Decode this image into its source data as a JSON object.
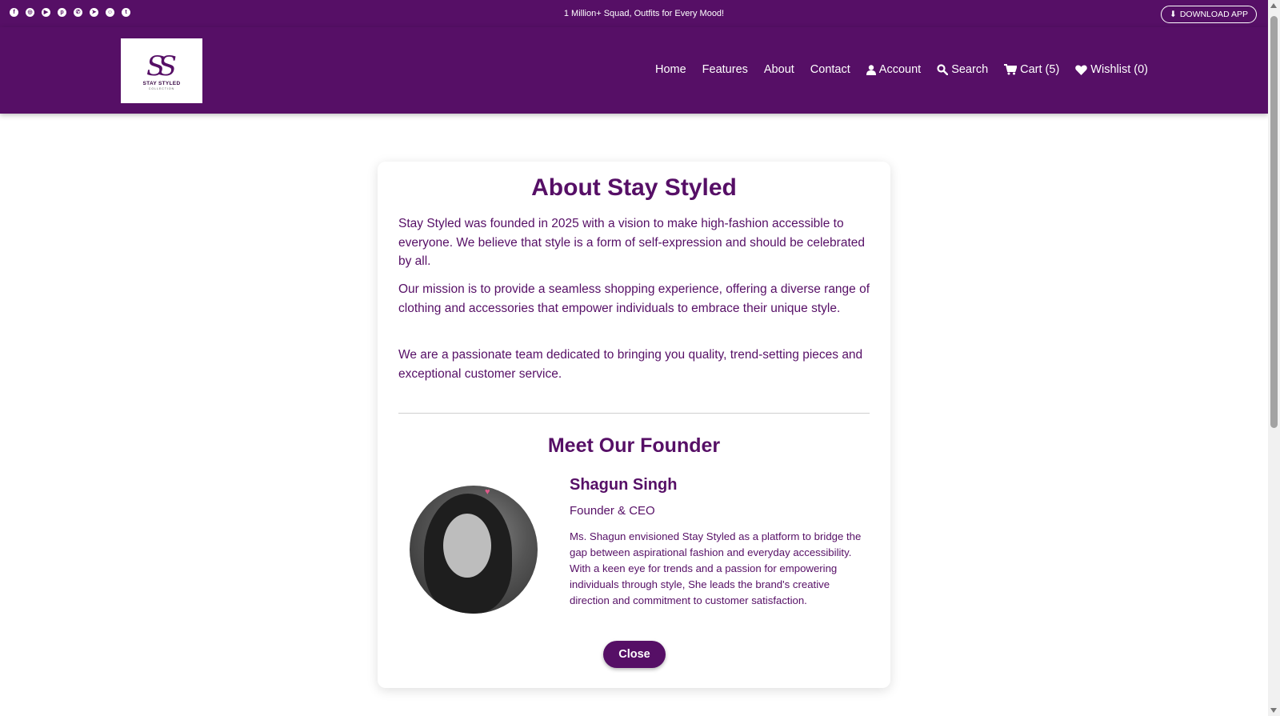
{
  "topbar": {
    "social_icons": [
      "facebook-icon",
      "instagram-icon",
      "youtube-icon",
      "pinterest-icon",
      "whatsapp-icon",
      "telegram-icon",
      "snapchat-icon",
      "twitter-icon"
    ],
    "social_glyphs": [
      "f",
      "◎",
      "▶",
      "p",
      "✆",
      "➤",
      "☺",
      "t"
    ],
    "promo_text": "1 Million+ Squad, Outfits for Every Mood!",
    "download_label": "DOWNLOAD APP"
  },
  "header": {
    "logo_mark": "SS",
    "logo_text": "STAY STYLED",
    "logo_sub": "COLLECTION",
    "nav": {
      "home": "Home",
      "features": "Features",
      "about": "About",
      "contact": "Contact",
      "account": "Account",
      "search": "Search",
      "cart": "Cart (5)",
      "wishlist": "Wishlist (0)"
    }
  },
  "about": {
    "title": "About Stay Styled",
    "paragraphs": [
      "Stay Styled was founded in 2025 with a vision to make high-fashion accessible to everyone. We believe that style is a form of self-expression and should be celebrated by all.",
      "Our mission is to provide a seamless shopping experience, offering a diverse range of clothing and accessories that empower individuals to embrace their unique style.",
      "We are a passionate team dedicated to bringing you quality, trend-setting pieces and exceptional customer service."
    ]
  },
  "founder": {
    "section_title": "Meet Our Founder",
    "name": "Shagun Singh",
    "role": "Founder & CEO",
    "bio": "Ms. Shagun envisioned Stay Styled as a platform to bridge the gap between aspirational fashion and everyday accessibility. With a keen eye for trends and a passion for empowering individuals through style, She leads the brand's creative direction and commitment to customer satisfaction."
  },
  "close_label": "Close",
  "colors": {
    "brand": "#560f66",
    "background": "#ffffff"
  }
}
